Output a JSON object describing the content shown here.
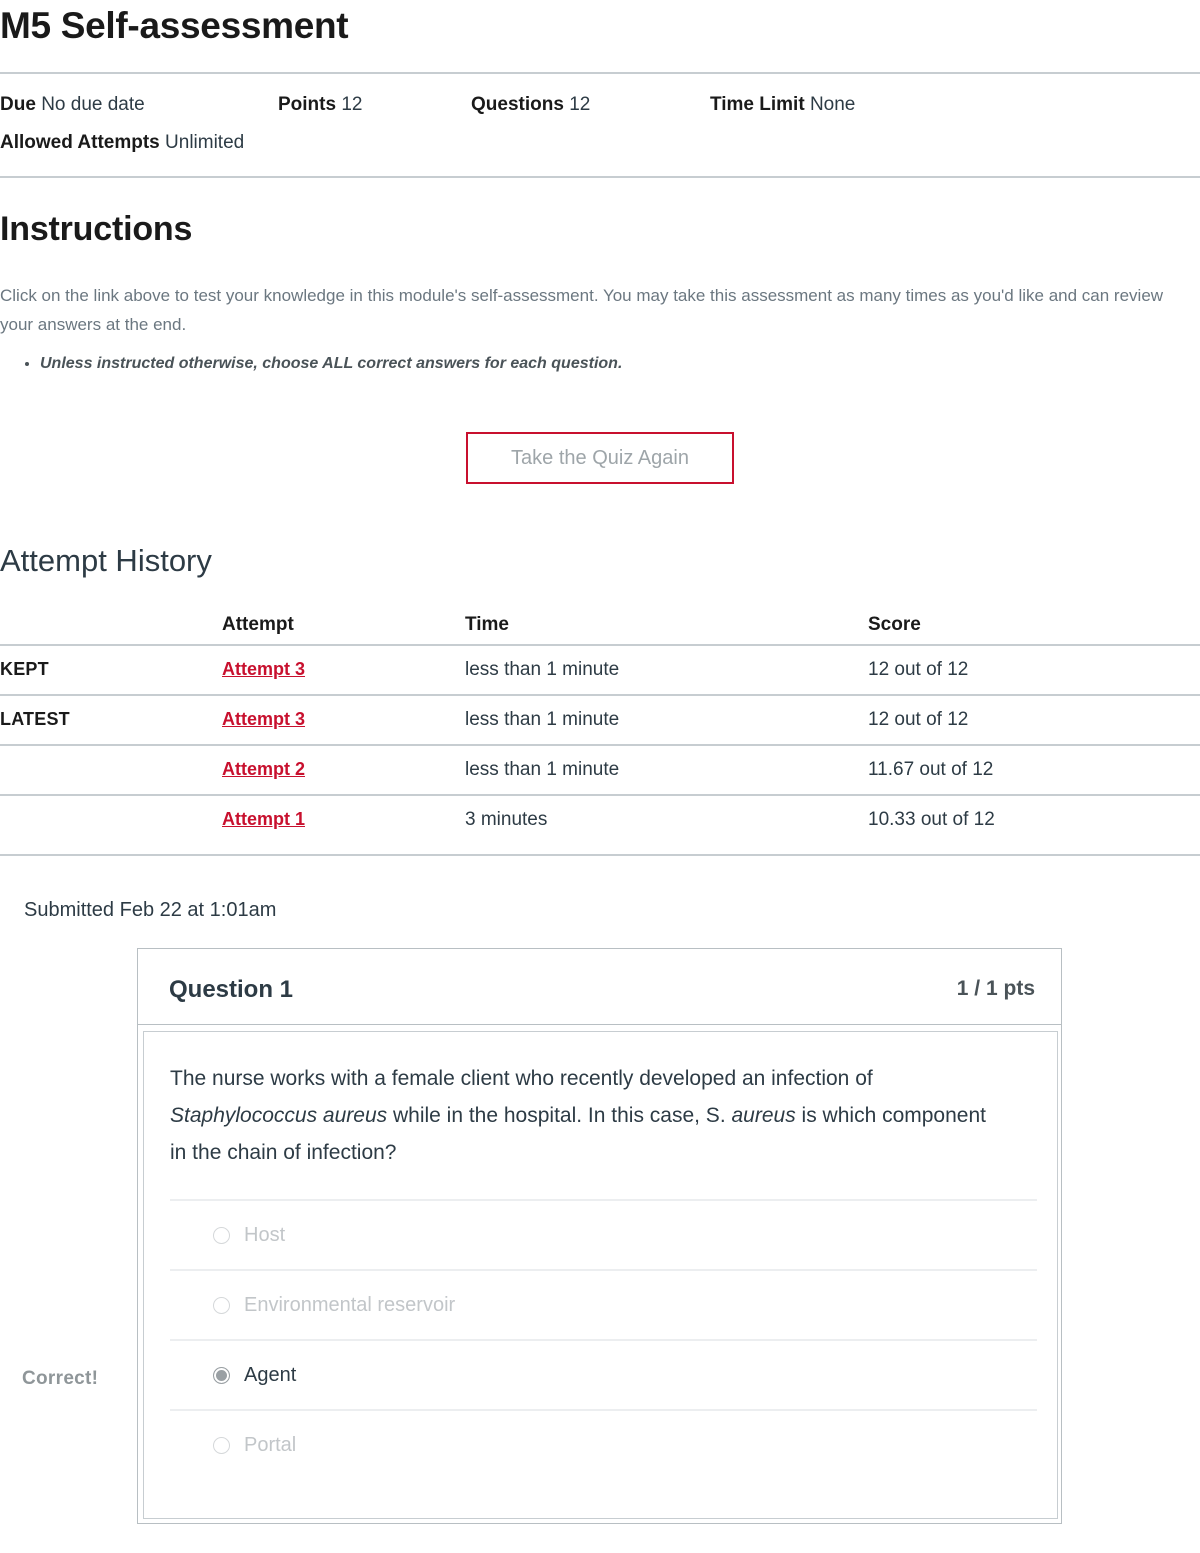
{
  "page_title": "M5 Self-assessment",
  "meta": {
    "due": {
      "key": "Due",
      "value": "No due date"
    },
    "points": {
      "key": "Points",
      "value": "12"
    },
    "questions": {
      "key": "Questions",
      "value": "12"
    },
    "time_limit": {
      "key": "Time Limit",
      "value": "None"
    },
    "allowed_attempts": {
      "key": "Allowed Attempts",
      "value": "Unlimited"
    }
  },
  "instructions": {
    "heading": "Instructions",
    "body": "Click on the link above to test your knowledge in this module's self-assessment. You may take this assessment as many times as you'd like and can review your answers at the end.",
    "bullets": [
      "Unless instructed otherwise, choose ALL correct answers for each question."
    ]
  },
  "take_quiz_button": "Take the Quiz Again",
  "attempt_history": {
    "heading": "Attempt History",
    "columns": [
      "",
      "Attempt",
      "Time",
      "Score"
    ],
    "rows": [
      {
        "label": "KEPT",
        "attempt": "Attempt 3",
        "time": "less than 1 minute",
        "score": "12 out of 12"
      },
      {
        "label": "LATEST",
        "attempt": "Attempt 3",
        "time": "less than 1 minute",
        "score": "12 out of 12"
      },
      {
        "label": "",
        "attempt": "Attempt 2",
        "time": "less than 1 minute",
        "score": "11.67 out of 12"
      },
      {
        "label": "",
        "attempt": "Attempt 1",
        "time": "3 minutes",
        "score": "10.33 out of 12"
      }
    ]
  },
  "submitted": "Submitted Feb 22 at 1:01am",
  "question": {
    "name": "Question 1",
    "points": "1 / 1 pts",
    "correct_label": "Correct!",
    "text_parts": {
      "p1": "The nurse works with a female client who recently developed an infection of ",
      "italic1": "Staphylococcus aureus",
      "p2": " while in the hospital. In this case, S. ",
      "italic2": "aureus",
      "p3": " is which component in the chain of infection?"
    },
    "answers": [
      {
        "label": "Host",
        "selected": false
      },
      {
        "label": "Environmental reservoir",
        "selected": false
      },
      {
        "label": "Agent",
        "selected": true
      },
      {
        "label": "Portal",
        "selected": false
      }
    ]
  },
  "colors": {
    "accent_red": "#c8102e",
    "rule": "#c7cdd1",
    "text": "#2d3b45",
    "muted": "#c2c6c9"
  }
}
